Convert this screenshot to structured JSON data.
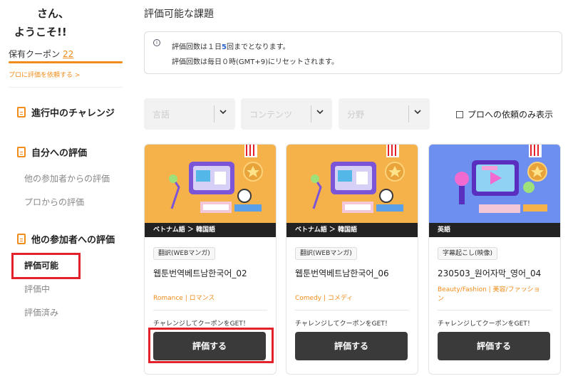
{
  "sidebar": {
    "greeting_line1": "さん、",
    "greeting_line2": "ようこそ!!",
    "coupon_label": "保有クーポン",
    "coupon_count": "22",
    "pro_request_link": "プロに評価を依頼する >",
    "sections": [
      {
        "label": "進行中のチャレンジ",
        "items": []
      },
      {
        "label": "自分への評価",
        "items": [
          "他の参加者からの評価",
          "プロからの評価"
        ]
      },
      {
        "label": "他の参加者への評価",
        "items": [
          "評価可能",
          "評価中",
          "評価済み"
        ]
      }
    ]
  },
  "main": {
    "title": "評価可能な課題",
    "info": {
      "line1_prefix": "評価回数は１日",
      "line1_count": "5",
      "line1_suffix": "回までとなります。",
      "line2": "評価回数は毎日０時(GMT+9)にリセットされます。"
    },
    "filters": {
      "language_placeholder": "言語",
      "content_placeholder": "コンテンツ",
      "field_placeholder": "分野",
      "pro_only_label": "プロへの依頼のみ表示"
    },
    "cards": [
      {
        "lang": "ベトナム語 ＞ 韓国語",
        "tag": "翻訳(WEBマンガ)",
        "title": "웹툰번역베트남한국어_02",
        "genre": "Romance | ロマンス",
        "cta": "チャレンジしてクーポンをGET！",
        "button": "評価する"
      },
      {
        "lang": "ベトナム語 ＞ 韓国語",
        "tag": "翻訳(WEBマンガ)",
        "title": "웹툰번역베트남한국어_06",
        "genre": "Comedy | コメディ",
        "cta": "チャレンジしてクーポンをGET！",
        "button": "評価する"
      },
      {
        "lang": "英語",
        "tag": "字幕起こし(映像)",
        "title": "230503_원어자막_영어_04",
        "genre": "Beauty/Fashion | 美容/ファッション",
        "cta": "チャレンジしてクーポンをGET！",
        "button": "評価する"
      }
    ]
  },
  "colors": {
    "accent": "#f08c1a",
    "highlight_red": "#e2212b",
    "info_blue": "#2a63c8",
    "button_dark": "#3a3a3a",
    "card_bg_orange": "#f6b24a",
    "card_bg_blue": "#6c8ff0"
  }
}
